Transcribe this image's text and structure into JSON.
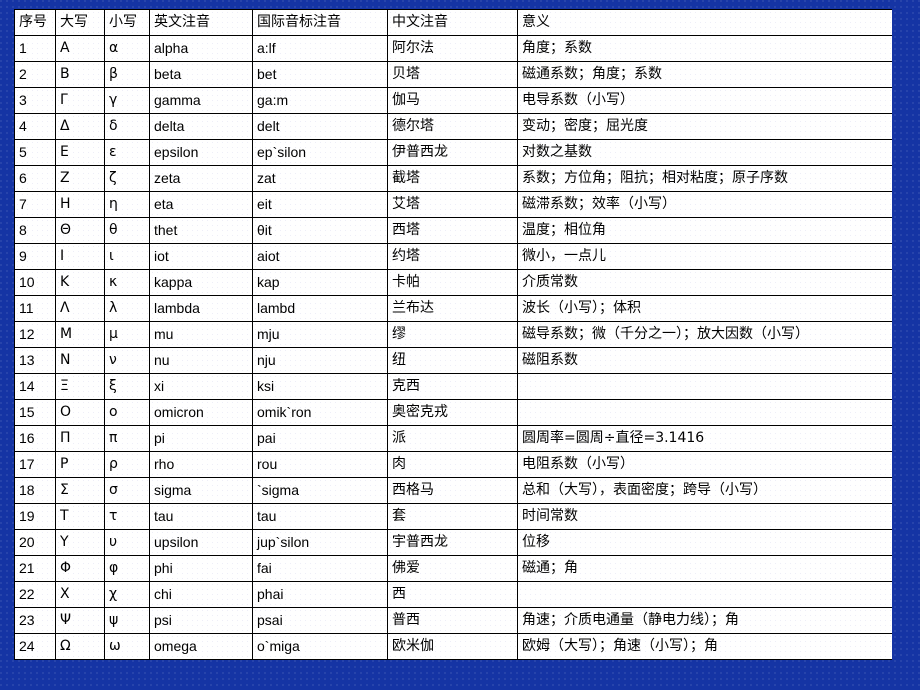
{
  "theme": {
    "background_color": "#1534a4",
    "table_background": "#ffffff",
    "border_color": "#000000",
    "text_color": "#000000"
  },
  "table": {
    "headers": [
      "序号",
      "大写",
      "小写",
      "英文注音",
      "国际音标注音",
      "中文注音",
      "意义"
    ],
    "rows": [
      {
        "num": "1",
        "upper": "Α",
        "lower": "α",
        "english": "alpha",
        "ipa": "a:lf",
        "chinese": "阿尔法",
        "meaning": "角度；系数"
      },
      {
        "num": "2",
        "upper": "Β",
        "lower": "β",
        "english": "beta",
        "ipa": "bet",
        "chinese": "贝塔",
        "meaning": "磁通系数；角度；系数"
      },
      {
        "num": "3",
        "upper": "Γ",
        "lower": "γ",
        "english": "gamma",
        "ipa": "ga:m",
        "chinese": "伽马",
        "meaning": "电导系数（小写）"
      },
      {
        "num": "4",
        "upper": "Δ",
        "lower": "δ",
        "english": "delta",
        "ipa": "delt",
        "chinese": "德尔塔",
        "meaning": "变动；密度；屈光度"
      },
      {
        "num": "5",
        "upper": "Ε",
        "lower": "ε",
        "english": "epsilon",
        "ipa": "ep`silon",
        "chinese": "伊普西龙",
        "meaning": "对数之基数"
      },
      {
        "num": "6",
        "upper": "Ζ",
        "lower": "ζ",
        "english": "zeta",
        "ipa": "zat",
        "chinese": "截塔",
        "meaning": "系数；方位角；阻抗；相对粘度；原子序数"
      },
      {
        "num": "7",
        "upper": "Η",
        "lower": "η",
        "english": "eta",
        "ipa": "eit",
        "chinese": "艾塔",
        "meaning": "磁滞系数；效率（小写）"
      },
      {
        "num": "8",
        "upper": "Θ",
        "lower": "θ",
        "english": "thet",
        "ipa": "θit",
        "chinese": "西塔",
        "meaning": "温度；相位角"
      },
      {
        "num": "9",
        "upper": "Ι",
        "lower": "ι",
        "english": "iot",
        "ipa": "aiot",
        "chinese": "约塔",
        "meaning": "微小，一点儿"
      },
      {
        "num": "10",
        "upper": "Κ",
        "lower": "κ",
        "english": "kappa",
        "ipa": "kap",
        "chinese": "卡帕",
        "meaning": "介质常数"
      },
      {
        "num": "11",
        "upper": "Λ",
        "lower": "λ",
        "english": "lambda",
        "ipa": "lambd",
        "chinese": "兰布达",
        "meaning": "波长（小写）；体积"
      },
      {
        "num": "12",
        "upper": "Μ",
        "lower": "μ",
        "english": "mu",
        "ipa": "mju",
        "chinese": "缪",
        "meaning": "磁导系数；微（千分之一）；放大因数（小写）"
      },
      {
        "num": "13",
        "upper": "Ν",
        "lower": "ν",
        "english": "nu",
        "ipa": "nju",
        "chinese": "纽",
        "meaning": "磁阻系数"
      },
      {
        "num": "14",
        "upper": "Ξ",
        "lower": "ξ",
        "english": "xi",
        "ipa": "ksi",
        "chinese": "克西",
        "meaning": ""
      },
      {
        "num": "15",
        "upper": "Ο",
        "lower": "ο",
        "english": "omicron",
        "ipa": "omik`ron",
        "chinese": "奥密克戎",
        "meaning": ""
      },
      {
        "num": "16",
        "upper": "Π",
        "lower": "π",
        "english": "pi",
        "ipa": "pai",
        "chinese": "派",
        "meaning": "圆周率=圆周÷直径=3.1416"
      },
      {
        "num": "17",
        "upper": "Ρ",
        "lower": "ρ",
        "english": "rho",
        "ipa": "rou",
        "chinese": "肉",
        "meaning": "电阻系数（小写）"
      },
      {
        "num": "18",
        "upper": "Σ",
        "lower": "σ",
        "english": "sigma",
        "ipa": "`sigma",
        "chinese": "西格马",
        "meaning": "总和（大写），表面密度；跨导（小写）"
      },
      {
        "num": "19",
        "upper": "Τ",
        "lower": "τ",
        "english": "tau",
        "ipa": "tau",
        "chinese": "套",
        "meaning": "时间常数"
      },
      {
        "num": "20",
        "upper": "Υ",
        "lower": "υ",
        "english": "upsilon",
        "ipa": "jup`silon",
        "chinese": "宇普西龙",
        "meaning": "位移"
      },
      {
        "num": "21",
        "upper": "Φ",
        "lower": "φ",
        "english": "phi",
        "ipa": "fai",
        "chinese": "佛爱",
        "meaning": "磁通；角"
      },
      {
        "num": "22",
        "upper": "Χ",
        "lower": "χ",
        "english": "chi",
        "ipa": "phai",
        "chinese": "西",
        "meaning": ""
      },
      {
        "num": "23",
        "upper": "Ψ",
        "lower": "ψ",
        "english": "psi",
        "ipa": "psai",
        "chinese": "普西",
        "meaning": "角速；介质电通量（静电力线）；角"
      },
      {
        "num": "24",
        "upper": "Ω",
        "lower": "ω",
        "english": "omega",
        "ipa": "o`miga",
        "chinese": "欧米伽",
        "meaning": "欧姆（大写）；角速（小写）；角"
      }
    ]
  }
}
